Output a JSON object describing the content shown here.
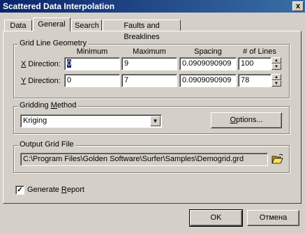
{
  "window": {
    "title": "Scattered Data Interpolation",
    "close": "x"
  },
  "tabs": [
    {
      "label": "Data",
      "active": false
    },
    {
      "label": "General",
      "active": true
    },
    {
      "label": "Search",
      "active": false
    },
    {
      "label": "Faults and Breaklines",
      "active": false
    }
  ],
  "grid_geometry": {
    "title": "Grid Line Geometry",
    "headers": {
      "minimum": "Minimum",
      "maximum": "Maximum",
      "spacing": "Spacing",
      "lines": "# of Lines"
    },
    "x": {
      "label_mnemonic": "X",
      "label_rest": " Direction:",
      "minimum": "0",
      "maximum": "9",
      "spacing": "0.0909090909",
      "lines": "100"
    },
    "y": {
      "label_mnemonic": "Y",
      "label_rest": " Direction:",
      "minimum": "0",
      "maximum": "7",
      "spacing": "0.0909090909",
      "lines": "78"
    }
  },
  "gridding": {
    "title_pre": "Gridding ",
    "title_mnemonic": "M",
    "title_post": "ethod",
    "method": "Kriging",
    "options_mnemonic": "O",
    "options_rest": "ptions..."
  },
  "output": {
    "title": "Output Grid File",
    "path": "C:\\Program Files\\Golden Software\\Surfer\\Samples\\Demogrid.grd"
  },
  "report": {
    "pre": "Generate ",
    "mnemonic": "R",
    "post": "eport",
    "checked": true
  },
  "buttons": {
    "ok": "OK",
    "cancel": "Отмена"
  },
  "colors": {
    "titlebar": "#0a246a",
    "face": "#d4d0c8"
  },
  "icons": {
    "close": "close-icon",
    "folder": "folder-open-icon"
  }
}
